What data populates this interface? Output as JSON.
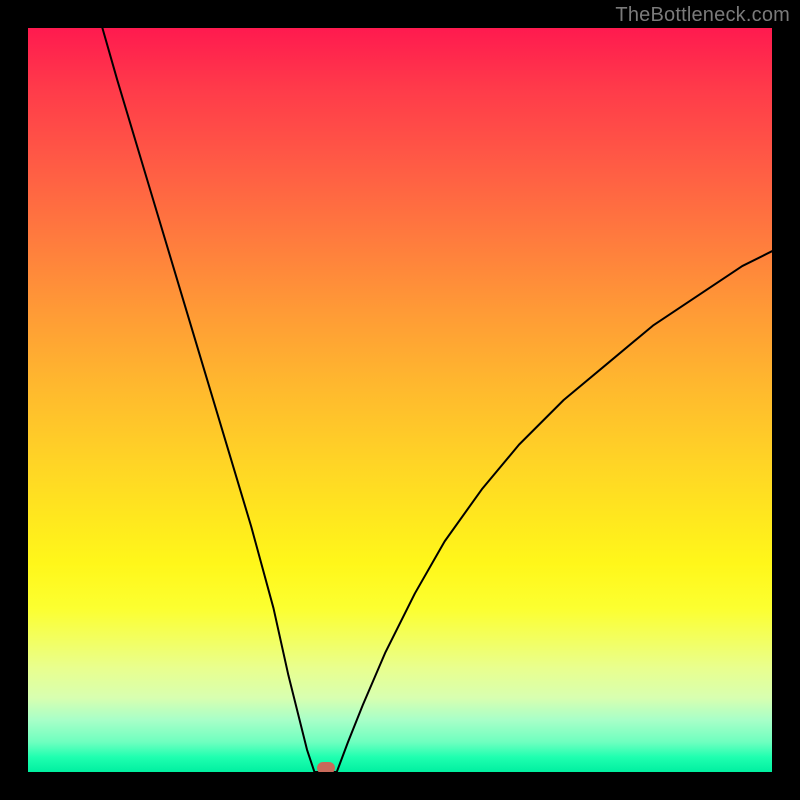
{
  "watermark": {
    "text": "TheBottleneck.com"
  },
  "colors": {
    "frame": "#000000",
    "curve": "#000000",
    "marker": "#c96a5a",
    "watermark": "#7a7a7a",
    "gradient_stops": [
      {
        "pos": 0.0,
        "hex": "#ff1a4f"
      },
      {
        "pos": 0.08,
        "hex": "#ff3a4a"
      },
      {
        "pos": 0.18,
        "hex": "#ff5a45"
      },
      {
        "pos": 0.28,
        "hex": "#ff7a3e"
      },
      {
        "pos": 0.38,
        "hex": "#ff9a36"
      },
      {
        "pos": 0.48,
        "hex": "#ffb82e"
      },
      {
        "pos": 0.58,
        "hex": "#ffd326"
      },
      {
        "pos": 0.66,
        "hex": "#ffe81e"
      },
      {
        "pos": 0.72,
        "hex": "#fff71a"
      },
      {
        "pos": 0.78,
        "hex": "#fcff30"
      },
      {
        "pos": 0.82,
        "hex": "#f3ff5e"
      },
      {
        "pos": 0.86,
        "hex": "#e9ff8e"
      },
      {
        "pos": 0.9,
        "hex": "#d8ffb0"
      },
      {
        "pos": 0.93,
        "hex": "#a8ffc8"
      },
      {
        "pos": 0.96,
        "hex": "#6effbf"
      },
      {
        "pos": 0.98,
        "hex": "#1fffb0"
      },
      {
        "pos": 1.0,
        "hex": "#00f0a0"
      }
    ]
  },
  "chart_data": {
    "type": "line",
    "title": "",
    "xlabel": "",
    "ylabel": "",
    "xlim": [
      0,
      100
    ],
    "ylim": [
      0,
      100
    ],
    "min_point": {
      "x": 40,
      "y": 0
    },
    "series": [
      {
        "name": "left-branch",
        "x": [
          10,
          12,
          15,
          18,
          21,
          24,
          27,
          30,
          33,
          35,
          36.5,
          37.5,
          38.5
        ],
        "y": [
          100,
          93,
          83,
          73,
          63,
          53,
          43,
          33,
          22,
          13,
          7,
          3,
          0
        ]
      },
      {
        "name": "floor",
        "x": [
          38.5,
          41.5
        ],
        "y": [
          0,
          0
        ]
      },
      {
        "name": "right-branch",
        "x": [
          41.5,
          43,
          45,
          48,
          52,
          56,
          61,
          66,
          72,
          78,
          84,
          90,
          96,
          100
        ],
        "y": [
          0,
          4,
          9,
          16,
          24,
          31,
          38,
          44,
          50,
          55,
          60,
          64,
          68,
          70
        ]
      }
    ],
    "marker": {
      "x": 40,
      "y": 0,
      "shape": "rounded-rect"
    }
  }
}
